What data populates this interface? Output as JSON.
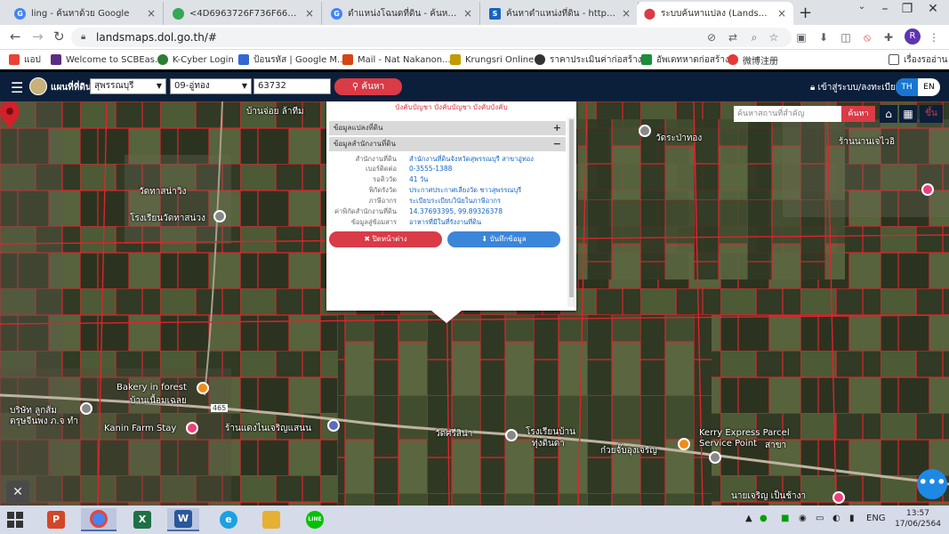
{
  "browser": {
    "tabs": [
      {
        "title": "ling - ค้นหาด้วย Google",
        "favicon_color": "#4285f4",
        "favicon_char": "G"
      },
      {
        "title": "<4D6963726F736F6674205768",
        "favicon_color": "#34a853",
        "favicon_char": ""
      },
      {
        "title": "ตำแหน่งโฉนดที่ดิน - ค้นหาด้วย Goo",
        "favicon_color": "#4285f4",
        "favicon_char": "G"
      },
      {
        "title": "ค้นหาตำแหน่งที่ดิน - http://dolwm",
        "favicon_color": "#1565c0",
        "favicon_char": "S"
      },
      {
        "title": "ระบบค้นหาแปลง (LandsMaps)",
        "favicon_color": "#d93b47",
        "favicon_char": ""
      }
    ],
    "new_tab": "+",
    "url": "landsmaps.dol.go.th/#",
    "profile_initial": "R",
    "bookmarks": [
      {
        "label": "แอป",
        "color": "#ea4335"
      },
      {
        "label": "Welcome to SCBEas...",
        "color": "#5b2c83"
      },
      {
        "label": "K-Cyber Login",
        "color": "#2e7d32"
      },
      {
        "label": "ป้อนรหัส | Google M...",
        "color": "#3367d6"
      },
      {
        "label": "Mail - Nat Nakanon...",
        "color": "#d84315"
      },
      {
        "label": "Krungsri Online",
        "color": "#c49a00"
      },
      {
        "label": "ราคาประเมินค่าก่อสร้าง...",
        "color": "#333333"
      },
      {
        "label": "อัพเดทหาดก่อสร้าง",
        "color": "#1b8e3a"
      },
      {
        "label": "微博注册",
        "color": "#e53935"
      }
    ],
    "reading_list": "เรื่องรออ่าน"
  },
  "app": {
    "title": "แผนที่ที่ดิน",
    "province": "สุพรรณบุรี",
    "district": "09-อู่ทอง",
    "parcel_no": "63732",
    "search_label": "ค้นหา",
    "login_label": "เข้าสู่ระบบ/ลงทะเบียน",
    "lang_th": "TH",
    "lang_en": "EN",
    "map_search_placeholder": "ค้นหาสถานที่สำคัญ",
    "map_search_btn": "ค้นหา",
    "toggle_label": "ขึ้น"
  },
  "popup": {
    "notice": "บังคับบัญชา บังคับบัญชา บังคับบังคับ",
    "section1": "ข้อมูลแปลงที่ดิน",
    "section1_toggle": "+",
    "section2": "ข้อมูลสำนักงานที่ดิน",
    "section2_toggle": "−",
    "rows": [
      {
        "k": "สำนักงานที่ดิน",
        "v": "สำนักงานที่ดินจังหวัดสุพรรณบุรี สาขาอู่ทอง"
      },
      {
        "k": "เบอร์ติดต่อ",
        "v": "0-3555-1388"
      },
      {
        "k": "รอคิววัด",
        "v": "41 วัน"
      },
      {
        "k": "พิกัดรังวัด",
        "v": "ประกาศประกาศเลี่ยงวัด ชาวสุพรรณบุรี"
      },
      {
        "k": "ภาษีอากร",
        "v": "ระเบียบระเบียบวินัยในภาษีอากร"
      },
      {
        "k": "ค่าพิกัดสำนักงานที่ดิน",
        "v": "14.37693395, 99.89326378"
      },
      {
        "k": "ข้อมูลสู่ข้อมสาร",
        "v": "อาหารที่มีในที่รังงานที่ดิน"
      }
    ],
    "close_label": "ปิดหน้าต่าง",
    "save_label": "บันทึกข้อมูล"
  },
  "map_labels": [
    {
      "text": "บ้านจ่อย ล้าทีม"
    },
    {
      "text": "วัดทาสน่าวิง"
    },
    {
      "text": "โรงเรียนวัดทาสน่วง"
    },
    {
      "text": "วัดระป่าทอง"
    },
    {
      "text": "ร้านนานเจไวอิ"
    },
    {
      "text": "Bakery in forest"
    },
    {
      "text": "บ้านเนื้อมเฉลย"
    },
    {
      "text": "บริษัท ลูกส้ม"
    },
    {
      "text": "ตรุษจีนพง ภ.จ ทำ"
    },
    {
      "text": "Kanin Farm Stay"
    },
    {
      "text": "ร้านแดงไนเจริญแสนน"
    },
    {
      "text": "วัดศรีสิน่า"
    },
    {
      "text": "โรงเรียนบ้าน"
    },
    {
      "text": "ทุ่งดินดา"
    },
    {
      "text": "Kerry Express Parcel"
    },
    {
      "text": "Service Point"
    },
    {
      "text": "สาขา"
    },
    {
      "text": "ก๋วยจั๊บอุงเจริญ"
    },
    {
      "text": "นายเจริญ เป็นช้างา"
    },
    {
      "text": "465"
    }
  ],
  "taskbar": {
    "apps": [
      {
        "label": "P",
        "color": "#d24726",
        "running": false
      },
      {
        "label": "",
        "color": "#4285f4",
        "running": true
      },
      {
        "label": "X",
        "color": "#1e7145",
        "running": false
      },
      {
        "label": "W",
        "color": "#2b579a",
        "running": true
      },
      {
        "label": "e",
        "color": "#1ba1e2",
        "running": false
      },
      {
        "label": "",
        "color": "#e6b033",
        "running": false
      },
      {
        "label": "LINE",
        "color": "#00c300",
        "running": false
      }
    ],
    "lang": "ENG",
    "time": "13:57",
    "date": "17/06/2564"
  }
}
